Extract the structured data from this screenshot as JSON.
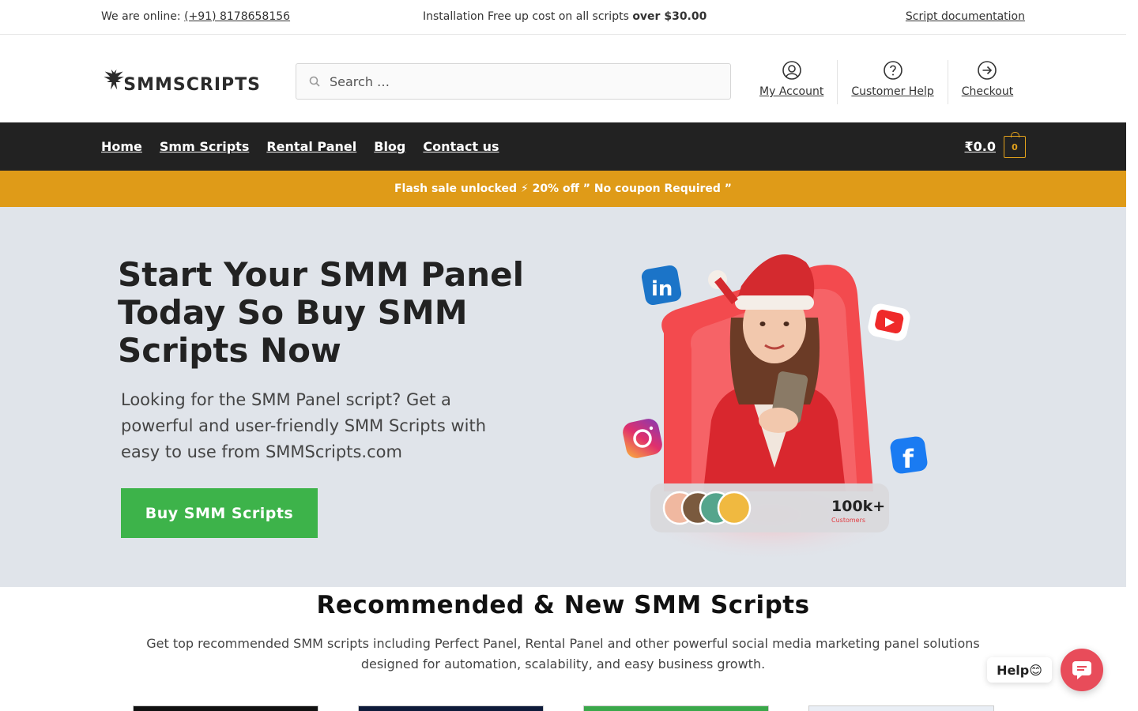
{
  "topbar": {
    "online_label": "We are online:",
    "phone": "(+91) 8178658156",
    "promo_text": "Installation Free up cost on all scripts",
    "promo_bold": "over $30.00",
    "doc_link": "Script documentation"
  },
  "header": {
    "logo_text": "SMMSCRIPTS",
    "search_placeholder": "Search …",
    "links": [
      {
        "label": "My Account",
        "icon": "user-circle-icon"
      },
      {
        "label": "Customer Help",
        "icon": "question-circle-icon"
      },
      {
        "label": "Checkout",
        "icon": "arrow-circle-right-icon"
      }
    ]
  },
  "nav": {
    "items": [
      "Home",
      "Smm Scripts",
      "Rental Panel",
      "Blog",
      "Contact us"
    ],
    "cart_amount": "₹0.0",
    "cart_count": "0"
  },
  "flash": {
    "text": "Flash sale unlocked ⚡ 20% off ” No coupon Required ”"
  },
  "hero": {
    "title": "Start Your SMM Panel Today So Buy SMM Scripts Now",
    "subtitle": "Looking for the SMM Panel script? Get a powerful and user-friendly SMM Scripts with easy to use from SMMScripts.com",
    "cta": "Buy SMM Scripts",
    "badge_number": "100k+",
    "badge_label": "Customers"
  },
  "section": {
    "title": "Recommended & New SMM Scripts",
    "description": "Get top recommended SMM scripts including Perfect Panel, Rental Panel and other powerful social media marketing panel solutions designed for automation, scalability, and easy business growth."
  },
  "help": {
    "label": "Help😊"
  },
  "colors": {
    "nav_bg": "#222222",
    "flash_bg": "#df9b18",
    "hero_bg": "#e0e4ea",
    "cta_bg": "#3db34a",
    "help_bg": "#e84c5a"
  }
}
